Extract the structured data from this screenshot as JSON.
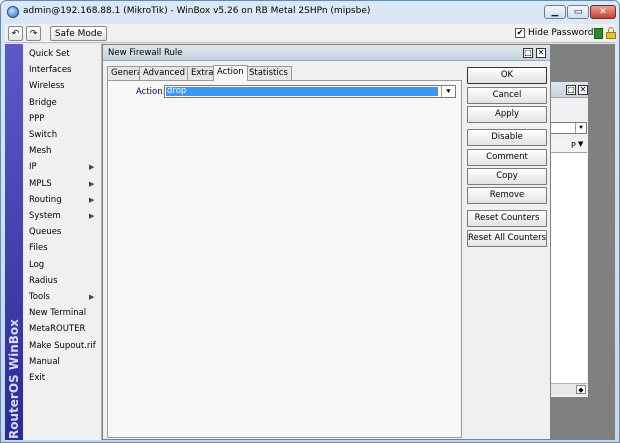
{
  "window": {
    "title": "admin@192.168.88.1 (MikroTik) - WinBox v5.26 on RB Metal 2SHPn (mipsbe)"
  },
  "toolbar": {
    "undo_glyph": "↶",
    "redo_glyph": "↷",
    "safe_mode_label": "Safe Mode",
    "hide_passwords_label": "Hide Passwords",
    "hide_passwords_checked": "✔"
  },
  "brand": {
    "text": "RouterOS WinBox"
  },
  "menu": {
    "items": [
      {
        "label": "Quick Set",
        "has_submenu": false
      },
      {
        "label": "Interfaces",
        "has_submenu": false
      },
      {
        "label": "Wireless",
        "has_submenu": false
      },
      {
        "label": "Bridge",
        "has_submenu": false
      },
      {
        "label": "PPP",
        "has_submenu": false
      },
      {
        "label": "Switch",
        "has_submenu": false
      },
      {
        "label": "Mesh",
        "has_submenu": false
      },
      {
        "label": "IP",
        "has_submenu": true
      },
      {
        "label": "MPLS",
        "has_submenu": true
      },
      {
        "label": "Routing",
        "has_submenu": true
      },
      {
        "label": "System",
        "has_submenu": true
      },
      {
        "label": "Queues",
        "has_submenu": false
      },
      {
        "label": "Files",
        "has_submenu": false
      },
      {
        "label": "Log",
        "has_submenu": false
      },
      {
        "label": "Radius",
        "has_submenu": false
      },
      {
        "label": "Tools",
        "has_submenu": true
      },
      {
        "label": "New Terminal",
        "has_submenu": false
      },
      {
        "label": "MetaROUTER",
        "has_submenu": false
      },
      {
        "label": "Make Supout.rif",
        "has_submenu": false
      },
      {
        "label": "Manual",
        "has_submenu": false
      },
      {
        "label": "Exit",
        "has_submenu": false
      }
    ]
  },
  "dialog": {
    "title": "New Firewall Rule",
    "tabs": [
      {
        "label": "General",
        "active": false
      },
      {
        "label": "Advanced",
        "active": false
      },
      {
        "label": "Extra",
        "active": false
      },
      {
        "label": "Action",
        "active": true
      },
      {
        "label": "Statistics",
        "active": false
      }
    ],
    "action_label": "Action:",
    "action_value": "drop",
    "buttons": {
      "ok": "OK",
      "cancel": "Cancel",
      "apply": "Apply",
      "disable": "Disable",
      "comment": "Comment",
      "copy": "Copy",
      "remove": "Remove",
      "reset_counters": "Reset Counters",
      "reset_all_counters": "Reset All Counters"
    }
  },
  "background_window": {
    "column_header": "P"
  }
}
